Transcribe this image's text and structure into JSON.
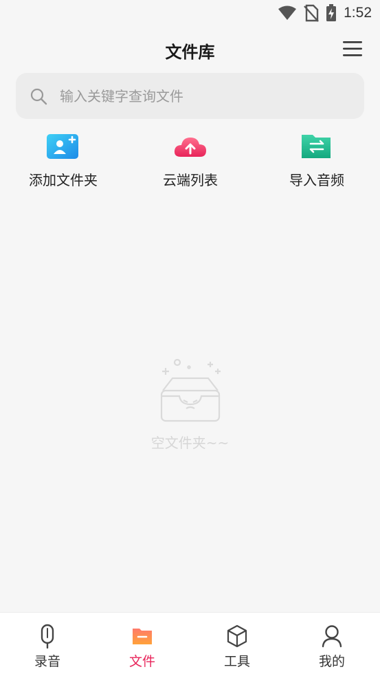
{
  "status_bar": {
    "time": "1:52"
  },
  "header": {
    "title": "文件库"
  },
  "search": {
    "placeholder": "输入关键字查询文件",
    "value": ""
  },
  "quick_actions": [
    {
      "label": "添加文件夹",
      "icon": "add-folder-icon"
    },
    {
      "label": "云端列表",
      "icon": "cloud-upload-icon"
    },
    {
      "label": "导入音频",
      "icon": "import-audio-icon"
    }
  ],
  "empty_state": {
    "text": "空文件夹~~"
  },
  "bottom_nav": [
    {
      "label": "录音",
      "icon": "microphone-icon",
      "active": false
    },
    {
      "label": "文件",
      "icon": "folder-icon",
      "active": true
    },
    {
      "label": "工具",
      "icon": "tools-cube-icon",
      "active": false
    },
    {
      "label": "我的",
      "icon": "profile-icon",
      "active": false
    }
  ],
  "colors": {
    "accent": "#e8245a",
    "background": "#f6f6f6",
    "nav_background": "#ffffff"
  }
}
